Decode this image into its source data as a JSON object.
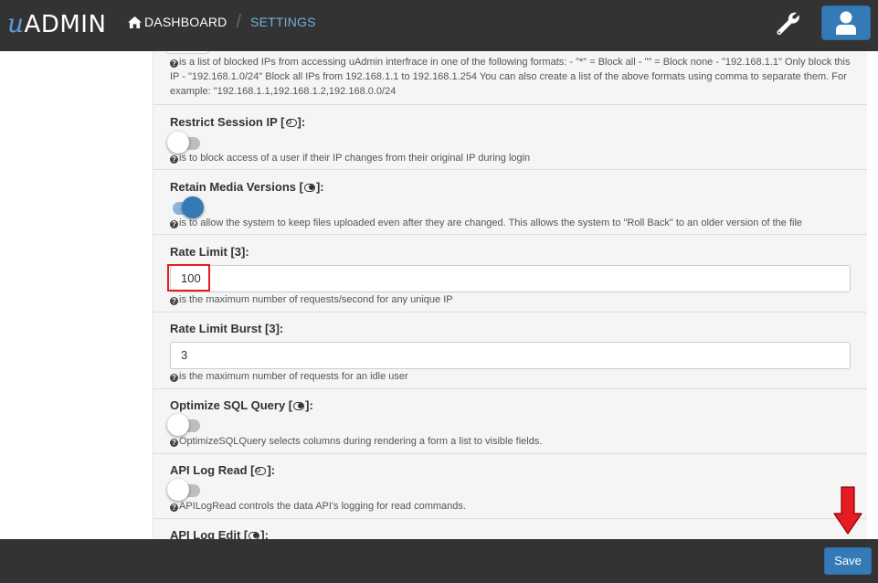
{
  "app": {
    "logo_u": "u",
    "logo_rest": "ADMIN"
  },
  "nav": {
    "dashboard_label": "DASHBOARD",
    "separator": "/",
    "settings_label": "SETTINGS"
  },
  "icons": {
    "home": "home-icon",
    "wrench": "wrench-icon",
    "user": "user-icon",
    "help": "question-circle-icon",
    "arrow": "arrow-down-icon"
  },
  "colors": {
    "topbar": "#333333",
    "accent": "#337ab7",
    "link_active": "#6cb1e1",
    "highlight": "#e51c23"
  },
  "fields": {
    "blocked_ips": {
      "help": "is a list of blocked IPs from accessing uAdmin interfrace in one of the following formats: - \"*\" = Block all - \"\" = Block none - \"192.168.1.1\" Only block this IP - \"192.168.1.0/24\" Block all IPs from 192.168.1.1 to 192.168.1.254 You can also create a list of the above formats using comma to separate them. For example: \"192.168.1.1,192.168.1.2,192.168.0.0/24"
    },
    "restrict_session_ip": {
      "label": "Restrict Session IP",
      "label_suffix": "]:",
      "toggle_on": false,
      "help": "is to block access of a user if their IP changes from their original IP during login"
    },
    "retain_media_versions": {
      "label": "Retain Media Versions",
      "label_suffix": "]:",
      "toggle_on": true,
      "help": "is to allow the system to keep files uploaded even after they are changed. This allows the system to \"Roll Back\" to an older version of the file"
    },
    "rate_limit": {
      "label": "Rate Limit [3]:",
      "value": "100",
      "help": "is the maximum number of requests/second for any unique IP"
    },
    "rate_limit_burst": {
      "label": "Rate Limit Burst [3]:",
      "value": "3",
      "help": "is the maximum number of requests for an idle user"
    },
    "optimize_sql_query": {
      "label": "Optimize SQL Query",
      "label_suffix": "]:",
      "toggle_on": false,
      "help": "OptimizeSQLQuery selects columns during rendering a form a list to visible fields."
    },
    "api_log_read": {
      "label": "API Log Read",
      "label_suffix": "]:",
      "toggle_on": false,
      "help": "APILogRead controls the data API's logging for read commands."
    },
    "api_log_edit": {
      "label": "API Log Edit",
      "label_suffix": "]:"
    }
  },
  "footer": {
    "save_label": "Save"
  }
}
